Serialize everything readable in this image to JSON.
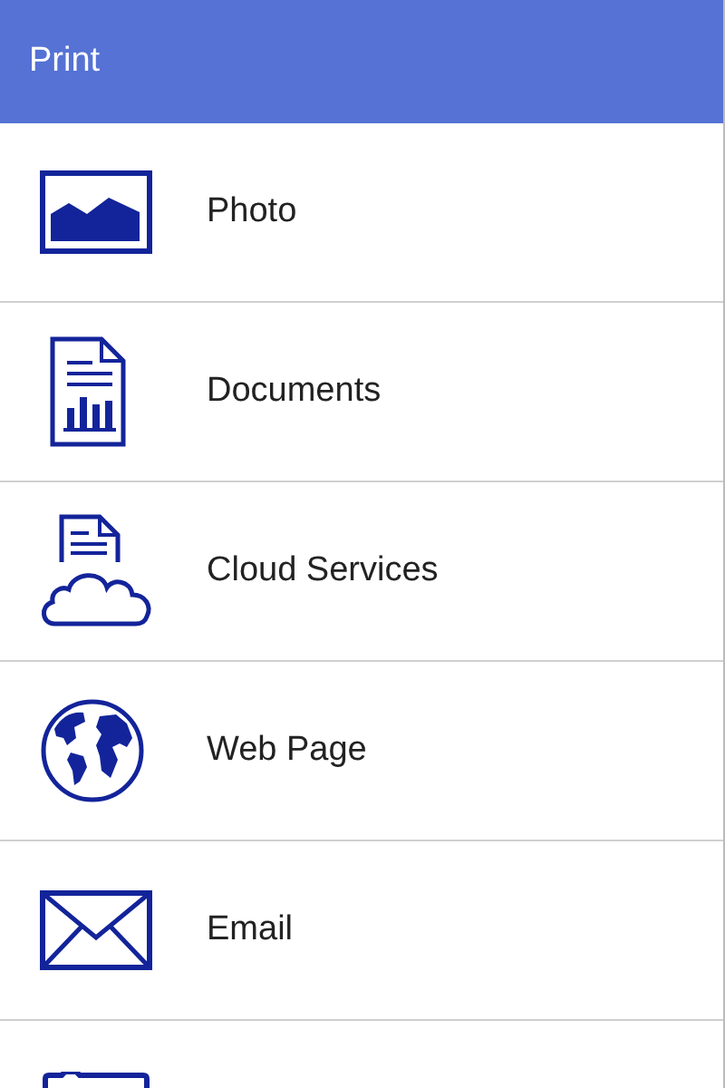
{
  "header": {
    "title": "Print"
  },
  "items": [
    {
      "kind": "photo",
      "label": "Photo"
    },
    {
      "kind": "document",
      "label": "Documents"
    },
    {
      "kind": "cloud",
      "label": "Cloud Services"
    },
    {
      "kind": "globe",
      "label": "Web Page"
    },
    {
      "kind": "mail",
      "label": "Email"
    },
    {
      "kind": "folder"
    }
  ]
}
